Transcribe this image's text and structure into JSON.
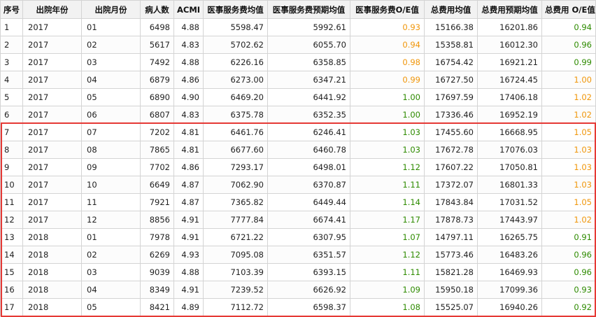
{
  "columns": [
    "序号",
    "出院年份",
    "出院月份",
    "病人数",
    "ACMI",
    "医事服务费均值",
    "医事服务费预期均值",
    "医事服务费O/E值",
    "总费用均值",
    "总费用预期均值",
    "总费用 O/E值"
  ],
  "colors": {
    "ratio_green": "#2e8b00",
    "ratio_orange": "#f0960a",
    "highlight_border": "#e53935",
    "header_bg": "#f2f2f2",
    "grid_line": "#d4d4d4"
  },
  "rows": [
    {
      "idx": "1",
      "year": "2017",
      "month": "01",
      "patients": "6498",
      "acmi": "4.88",
      "svc_mean": "5598.47",
      "svc_exp": "5992.61",
      "svc_oe": "0.93",
      "svc_oe_color": "#f0960a",
      "tot_mean": "15166.38",
      "tot_exp": "16201.86",
      "tot_oe": "0.94",
      "tot_oe_color": "#2e8b00"
    },
    {
      "idx": "2",
      "year": "2017",
      "month": "02",
      "patients": "5617",
      "acmi": "4.83",
      "svc_mean": "5702.62",
      "svc_exp": "6055.70",
      "svc_oe": "0.94",
      "svc_oe_color": "#f0960a",
      "tot_mean": "15358.81",
      "tot_exp": "16012.30",
      "tot_oe": "0.96",
      "tot_oe_color": "#2e8b00"
    },
    {
      "idx": "3",
      "year": "2017",
      "month": "03",
      "patients": "7492",
      "acmi": "4.88",
      "svc_mean": "6226.16",
      "svc_exp": "6358.85",
      "svc_oe": "0.98",
      "svc_oe_color": "#f0960a",
      "tot_mean": "16754.42",
      "tot_exp": "16921.21",
      "tot_oe": "0.99",
      "tot_oe_color": "#2e8b00"
    },
    {
      "idx": "4",
      "year": "2017",
      "month": "04",
      "patients": "6879",
      "acmi": "4.86",
      "svc_mean": "6273.00",
      "svc_exp": "6347.21",
      "svc_oe": "0.99",
      "svc_oe_color": "#f0960a",
      "tot_mean": "16727.50",
      "tot_exp": "16724.45",
      "tot_oe": "1.00",
      "tot_oe_color": "#f0960a"
    },
    {
      "idx": "5",
      "year": "2017",
      "month": "05",
      "patients": "6890",
      "acmi": "4.90",
      "svc_mean": "6469.20",
      "svc_exp": "6441.92",
      "svc_oe": "1.00",
      "svc_oe_color": "#2e8b00",
      "tot_mean": "17697.59",
      "tot_exp": "17406.18",
      "tot_oe": "1.02",
      "tot_oe_color": "#f0960a"
    },
    {
      "idx": "6",
      "year": "2017",
      "month": "06",
      "patients": "6807",
      "acmi": "4.83",
      "svc_mean": "6375.78",
      "svc_exp": "6352.35",
      "svc_oe": "1.00",
      "svc_oe_color": "#2e8b00",
      "tot_mean": "17336.46",
      "tot_exp": "16952.19",
      "tot_oe": "1.02",
      "tot_oe_color": "#f0960a"
    },
    {
      "idx": "7",
      "year": "2017",
      "month": "07",
      "patients": "7202",
      "acmi": "4.81",
      "svc_mean": "6461.76",
      "svc_exp": "6246.41",
      "svc_oe": "1.03",
      "svc_oe_color": "#2e8b00",
      "tot_mean": "17455.60",
      "tot_exp": "16668.95",
      "tot_oe": "1.05",
      "tot_oe_color": "#f0960a"
    },
    {
      "idx": "8",
      "year": "2017",
      "month": "08",
      "patients": "7865",
      "acmi": "4.81",
      "svc_mean": "6677.60",
      "svc_exp": "6460.78",
      "svc_oe": "1.03",
      "svc_oe_color": "#2e8b00",
      "tot_mean": "17672.78",
      "tot_exp": "17076.03",
      "tot_oe": "1.03",
      "tot_oe_color": "#f0960a"
    },
    {
      "idx": "9",
      "year": "2017",
      "month": "09",
      "patients": "7702",
      "acmi": "4.86",
      "svc_mean": "7293.17",
      "svc_exp": "6498.01",
      "svc_oe": "1.12",
      "svc_oe_color": "#2e8b00",
      "tot_mean": "17607.22",
      "tot_exp": "17050.81",
      "tot_oe": "1.03",
      "tot_oe_color": "#f0960a"
    },
    {
      "idx": "10",
      "year": "2017",
      "month": "10",
      "patients": "6649",
      "acmi": "4.87",
      "svc_mean": "7062.90",
      "svc_exp": "6370.87",
      "svc_oe": "1.11",
      "svc_oe_color": "#2e8b00",
      "tot_mean": "17372.07",
      "tot_exp": "16801.33",
      "tot_oe": "1.03",
      "tot_oe_color": "#f0960a"
    },
    {
      "idx": "11",
      "year": "2017",
      "month": "11",
      "patients": "7921",
      "acmi": "4.87",
      "svc_mean": "7365.82",
      "svc_exp": "6449.44",
      "svc_oe": "1.14",
      "svc_oe_color": "#2e8b00",
      "tot_mean": "17843.84",
      "tot_exp": "17031.52",
      "tot_oe": "1.05",
      "tot_oe_color": "#f0960a"
    },
    {
      "idx": "12",
      "year": "2017",
      "month": "12",
      "patients": "8856",
      "acmi": "4.91",
      "svc_mean": "7777.84",
      "svc_exp": "6674.41",
      "svc_oe": "1.17",
      "svc_oe_color": "#2e8b00",
      "tot_mean": "17878.73",
      "tot_exp": "17443.97",
      "tot_oe": "1.02",
      "tot_oe_color": "#f0960a"
    },
    {
      "idx": "13",
      "year": "2018",
      "month": "01",
      "patients": "7978",
      "acmi": "4.91",
      "svc_mean": "6721.22",
      "svc_exp": "6307.95",
      "svc_oe": "1.07",
      "svc_oe_color": "#2e8b00",
      "tot_mean": "14797.11",
      "tot_exp": "16265.75",
      "tot_oe": "0.91",
      "tot_oe_color": "#2e8b00"
    },
    {
      "idx": "14",
      "year": "2018",
      "month": "02",
      "patients": "6269",
      "acmi": "4.93",
      "svc_mean": "7095.08",
      "svc_exp": "6351.57",
      "svc_oe": "1.12",
      "svc_oe_color": "#2e8b00",
      "tot_mean": "15773.46",
      "tot_exp": "16483.26",
      "tot_oe": "0.96",
      "tot_oe_color": "#2e8b00"
    },
    {
      "idx": "15",
      "year": "2018",
      "month": "03",
      "patients": "9039",
      "acmi": "4.88",
      "svc_mean": "7103.39",
      "svc_exp": "6393.15",
      "svc_oe": "1.11",
      "svc_oe_color": "#2e8b00",
      "tot_mean": "15821.28",
      "tot_exp": "16469.93",
      "tot_oe": "0.96",
      "tot_oe_color": "#2e8b00"
    },
    {
      "idx": "16",
      "year": "2018",
      "month": "04",
      "patients": "8349",
      "acmi": "4.91",
      "svc_mean": "7239.52",
      "svc_exp": "6626.92",
      "svc_oe": "1.09",
      "svc_oe_color": "#2e8b00",
      "tot_mean": "15950.18",
      "tot_exp": "17099.36",
      "tot_oe": "0.93",
      "tot_oe_color": "#2e8b00"
    },
    {
      "idx": "17",
      "year": "2018",
      "month": "05",
      "patients": "8421",
      "acmi": "4.89",
      "svc_mean": "7112.72",
      "svc_exp": "6598.37",
      "svc_oe": "1.08",
      "svc_oe_color": "#2e8b00",
      "tot_mean": "15525.07",
      "tot_exp": "16940.26",
      "tot_oe": "0.92",
      "tot_oe_color": "#2e8b00"
    }
  ]
}
